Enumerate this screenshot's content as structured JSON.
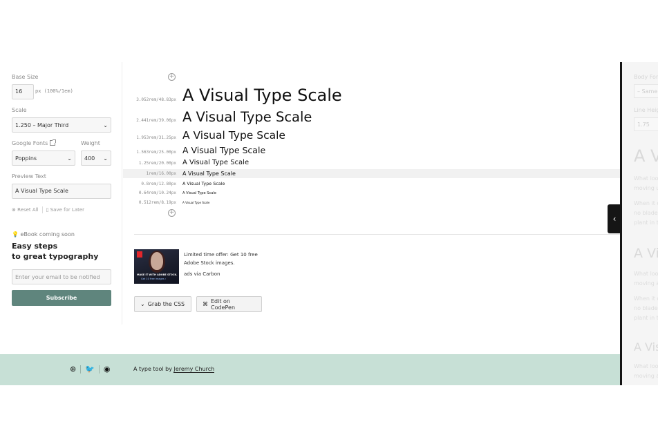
{
  "sidebar": {
    "base_size_label": "Base Size",
    "base_size_value": "16",
    "base_size_hint": "px (100%/1em)",
    "scale_label": "Scale",
    "scale_value": "1.250 – Major Third",
    "google_fonts_label": "Google Fonts",
    "weight_label": "Weight",
    "font_value": "Poppins",
    "weight_value": "400",
    "preview_text_label": "Preview Text",
    "preview_text_value": "A Visual Type Scale",
    "reset_label": "Reset All",
    "save_label": "Save for Later",
    "ebook_label": "eBook coming soon",
    "ebook_title_line1": "Easy steps",
    "ebook_title_line2": "to great typography",
    "email_placeholder": "Enter your email to be notified",
    "subscribe_label": "Subscribe"
  },
  "scale": {
    "rows": [
      {
        "meta": "3.052rem/48.83px",
        "sample": "A Visual Type Scale"
      },
      {
        "meta": "2.441rem/39.06px",
        "sample": "A Visual Type Scale"
      },
      {
        "meta": "1.953rem/31.25px",
        "sample": "A Visual Type Scale"
      },
      {
        "meta": "1.563rem/25.00px",
        "sample": "A Visual Type Scale"
      },
      {
        "meta": "1.25rem/20.00px",
        "sample": "A Visual Type Scale"
      },
      {
        "meta": "1rem/16.00px",
        "sample": "A Visual Type Scale"
      },
      {
        "meta": "0.8rem/12.80px",
        "sample": "A Visual Type Scale"
      },
      {
        "meta": "0.64rem/10.24px",
        "sample": "A Visual Type Scale"
      },
      {
        "meta": "0.512rem/8.19px",
        "sample": "A Visual Type Scale"
      }
    ],
    "add_icon": "plus-circle-icon"
  },
  "ad": {
    "line1": "Limited time offer: Get 10 free",
    "line2": "Adobe Stock images.",
    "via": "ads via Carbon",
    "image_text1": "MAKE IT WITH ADOBE STOCK.",
    "image_text2": "Get 10 free images ›"
  },
  "actions": {
    "grab_css": "Grab the CSS",
    "codepen": "Edit on CodePen"
  },
  "drawer": {
    "body_font_label": "Body For",
    "body_font_value": "– Same",
    "line_height_label": "Line Heig",
    "line_height_value": "1.75",
    "heading1": "A V",
    "para1_line1": "What loo",
    "para1_line2": "moving u",
    "para2_line1": "When it c",
    "para2_line2": "no blade",
    "para2_line3": "plant in t",
    "heading2": "A Vi",
    "para3_line1": "What loo",
    "para3_line2": "moving a",
    "para4_line1": "When it c",
    "para4_line2": "no blade",
    "para4_line3": "plant in t",
    "heading3": "A Vis",
    "para5_line1": "What loo",
    "para5_line2": "moving a",
    "toggle_icon": "chevron-left-icon"
  },
  "footer": {
    "prefix": "A type tool by ",
    "author": "Jeremy Church",
    "icons": [
      "globe-icon",
      "twitter-icon",
      "github-icon"
    ]
  },
  "colors": {
    "accent": "#5f857d",
    "footer_bg": "#c7e0d6",
    "drawer_edge": "#151515"
  }
}
